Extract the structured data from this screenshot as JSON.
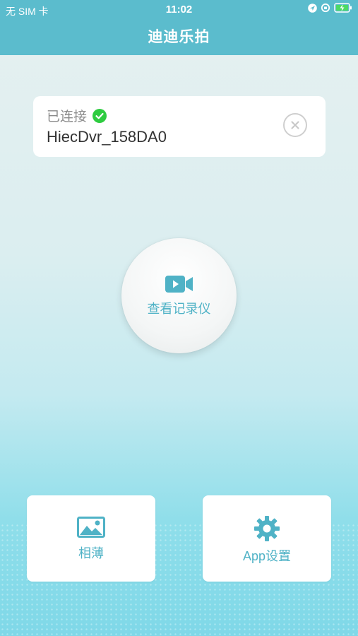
{
  "status_bar": {
    "carrier": "无 SIM 卡",
    "time": "11:02"
  },
  "nav": {
    "title": "迪迪乐拍"
  },
  "connection": {
    "status_label": "已连接",
    "device_name": "HiecDvr_158DA0"
  },
  "main_action": {
    "label": "查看记录仪"
  },
  "tiles": {
    "album_label": "相薄",
    "settings_label": "App设置"
  },
  "colors": {
    "accent": "#4fb2c6",
    "header": "#5bbccd",
    "connected": "#2ecc40"
  }
}
